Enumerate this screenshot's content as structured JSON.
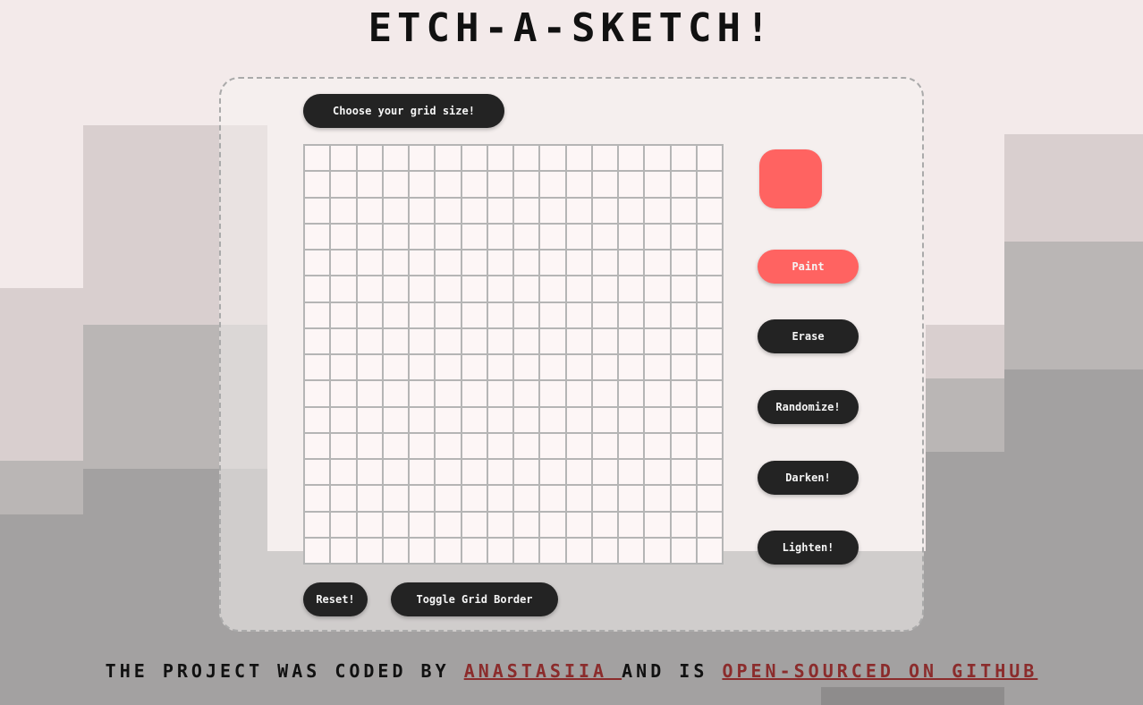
{
  "title": "ETCH-A-SKETCH!",
  "controls": {
    "grid_size_label": "Choose your grid size!",
    "color_swatch": "#ff6361",
    "mode_buttons": [
      "Paint",
      "Erase",
      "Randomize!",
      "Darken!",
      "Lighten!"
    ],
    "active_mode": "Paint",
    "reset_label": "Reset!",
    "toggle_border_label": "Toggle Grid Border"
  },
  "grid": {
    "rows": 16,
    "columns": 16,
    "cell_color": "#fdf6f6",
    "border_color": "#b5b5b5"
  },
  "footer": {
    "text_before": "THE PROJECT WAS CODED BY ",
    "author_link": "ANASTASIIA ",
    "text_middle": "AND IS ",
    "repo_link": "OPEN-SOURCED ON GITHUB"
  },
  "colors": {
    "accent": "#ff6361",
    "button_dark": "#232323",
    "background": "#f3eaea"
  }
}
